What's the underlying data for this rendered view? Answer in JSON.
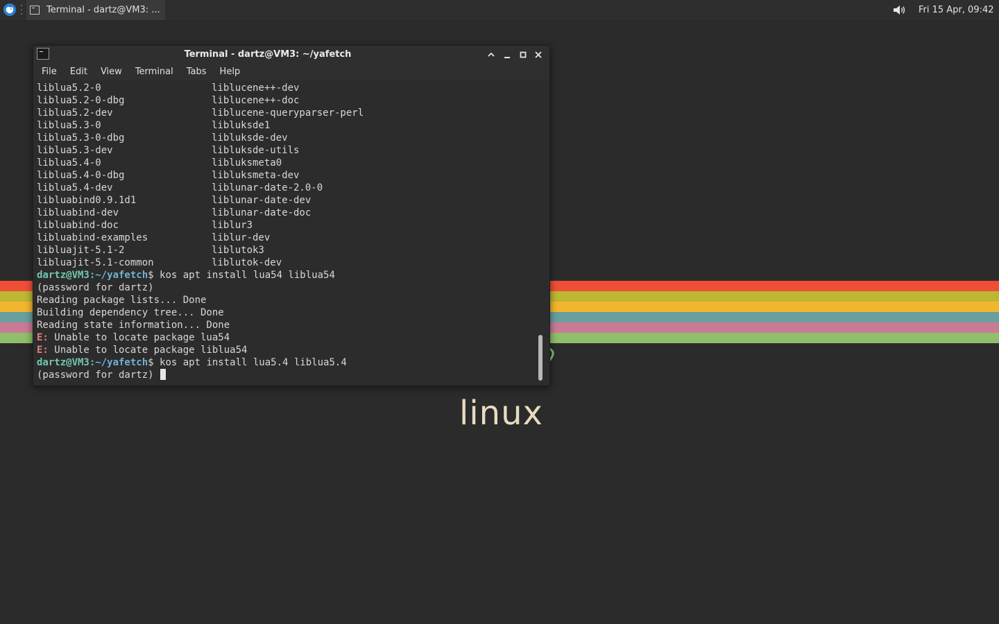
{
  "panel": {
    "task_title": "Terminal - dartz@VM3: ...",
    "clock": "Fri 15 Apr, 09:42",
    "icons": [
      "whisker-menu-icon",
      "terminal-icon",
      "volume-icon"
    ]
  },
  "wallpaper": {
    "word": "linux",
    "stripe_colors": [
      "#f04e37",
      "#bdb733",
      "#f2b62e",
      "#6a9f9f",
      "#c97b95",
      "#8fbf6b"
    ]
  },
  "window": {
    "title": "Terminal - dartz@VM3: ~/yafetch",
    "menu": [
      "File",
      "Edit",
      "View",
      "Terminal",
      "Tabs",
      "Help"
    ],
    "package_list": [
      {
        "col1": "liblua5.2-0",
        "col2": "liblucene++-dev"
      },
      {
        "col1": "liblua5.2-0-dbg",
        "col2": "liblucene++-doc"
      },
      {
        "col1": "liblua5.2-dev",
        "col2": "liblucene-queryparser-perl"
      },
      {
        "col1": "liblua5.3-0",
        "col2": "libluksde1"
      },
      {
        "col1": "liblua5.3-0-dbg",
        "col2": "libluksde-dev"
      },
      {
        "col1": "liblua5.3-dev",
        "col2": "libluksde-utils"
      },
      {
        "col1": "liblua5.4-0",
        "col2": "libluksmeta0"
      },
      {
        "col1": "liblua5.4-0-dbg",
        "col2": "libluksmeta-dev"
      },
      {
        "col1": "liblua5.4-dev",
        "col2": "liblunar-date-2.0-0"
      },
      {
        "col1": "libluabind0.9.1d1",
        "col2": "liblunar-date-dev"
      },
      {
        "col1": "libluabind-dev",
        "col2": "liblunar-date-doc"
      },
      {
        "col1": "libluabind-doc",
        "col2": "liblur3"
      },
      {
        "col1": "libluabind-examples",
        "col2": "liblur-dev"
      },
      {
        "col1": "libluajit-5.1-2",
        "col2": "liblutok3"
      },
      {
        "col1": "libluajit-5.1-common",
        "col2": "liblutok-dev"
      }
    ],
    "prompt_user": "dartz@VM3",
    "prompt_path": ":~/yafetch",
    "prompt_symbol": "$",
    "cmd1": " kos apt install lua54 liblua54",
    "password_prompt": "(password for dartz)",
    "out_reading": "Reading package lists... Done",
    "out_building": "Building dependency tree... Done",
    "out_state": "Reading state information... Done",
    "err_prefix": "E:",
    "err1": " Unable to locate package lua54",
    "err2": " Unable to locate package liblua54",
    "cmd2": " kos apt install lua5.4 liblua5.4",
    "password_prompt2": "(password for dartz) "
  }
}
